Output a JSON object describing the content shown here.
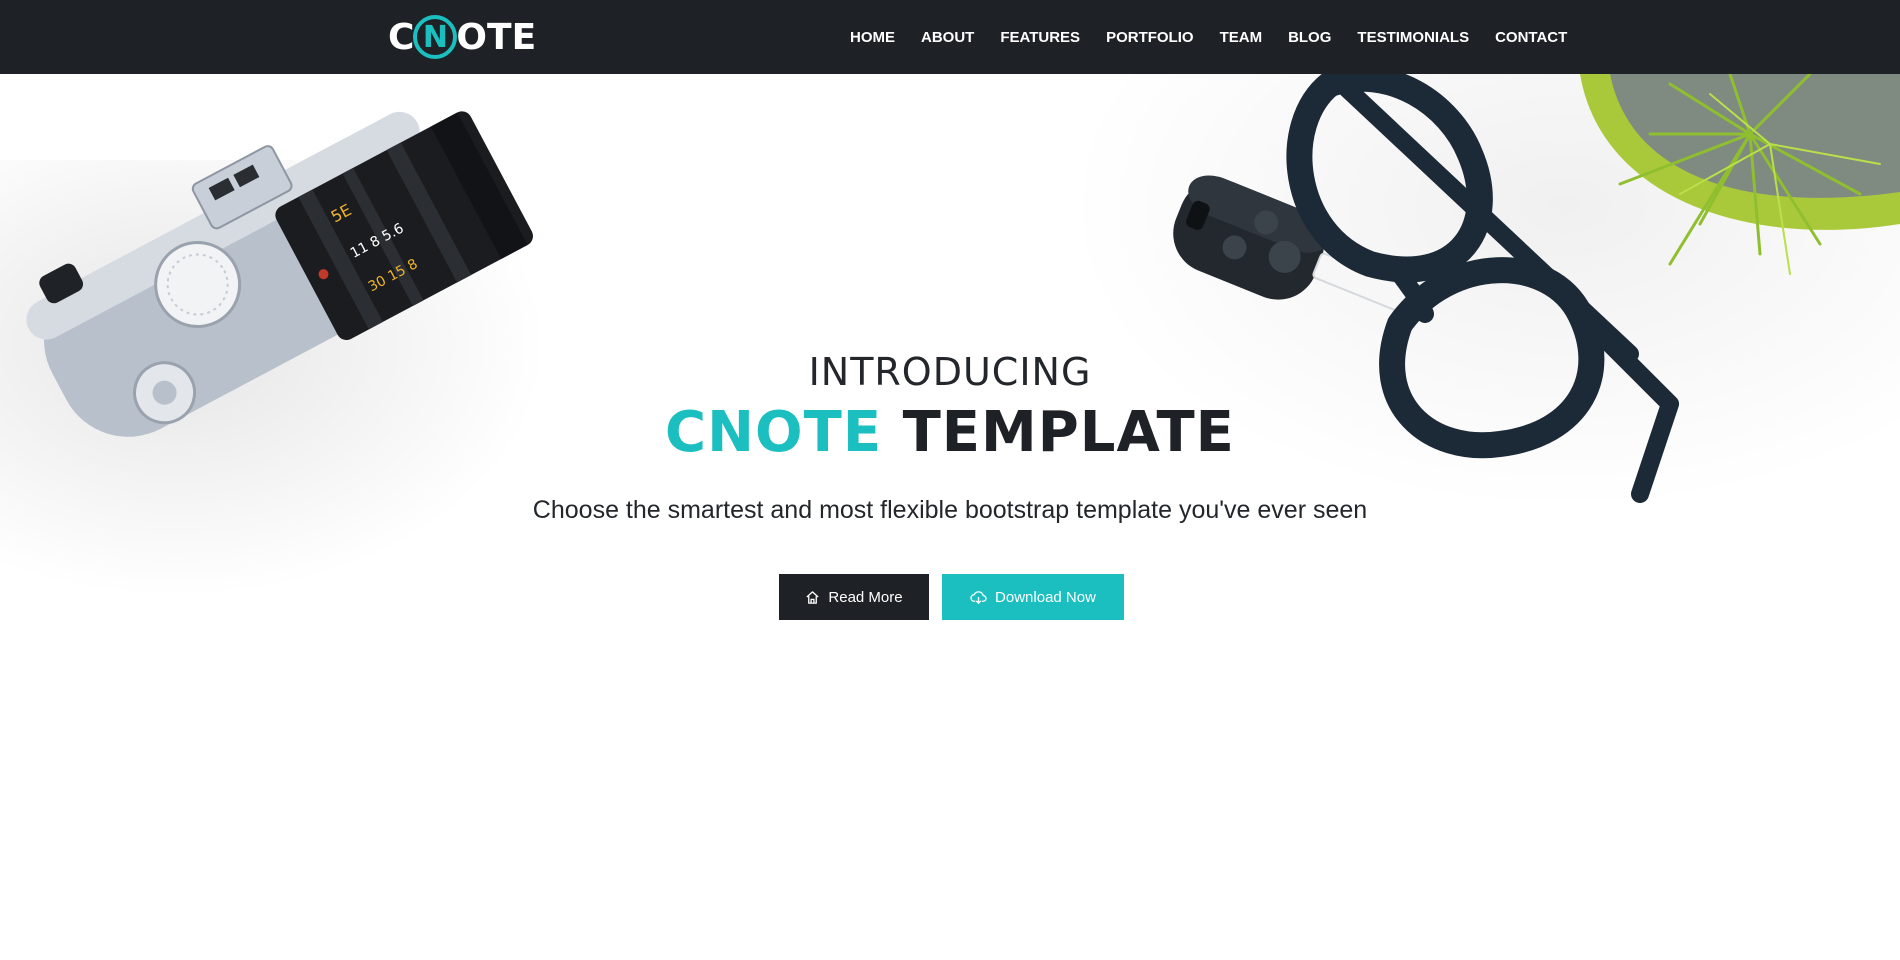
{
  "brand": {
    "logo_prefix": "C",
    "logo_ring_letter": "N",
    "logo_suffix": "OTE",
    "accent_color": "#1bbfbf",
    "dark_color": "#1e2226"
  },
  "nav": {
    "items": [
      {
        "label": "HOME"
      },
      {
        "label": "ABOUT"
      },
      {
        "label": "FEATURES"
      },
      {
        "label": "PORTFOLIO"
      },
      {
        "label": "TEAM"
      },
      {
        "label": "BLOG"
      },
      {
        "label": "TESTIMONIALS"
      },
      {
        "label": "CONTACT"
      }
    ]
  },
  "hero": {
    "pretitle": "INTRODUCING",
    "title_accent": "CNOTE",
    "title_rest": "TEMPLATE",
    "subtitle": "Choose the smartest and most flexible bootstrap template you've ever seen",
    "buttons": {
      "read_more": {
        "label": "Read More",
        "icon": "home-icon"
      },
      "download": {
        "label": "Download Now",
        "icon": "cloud-download-icon"
      }
    },
    "decor": [
      "camera",
      "car-key",
      "glasses",
      "potted-plant"
    ]
  }
}
